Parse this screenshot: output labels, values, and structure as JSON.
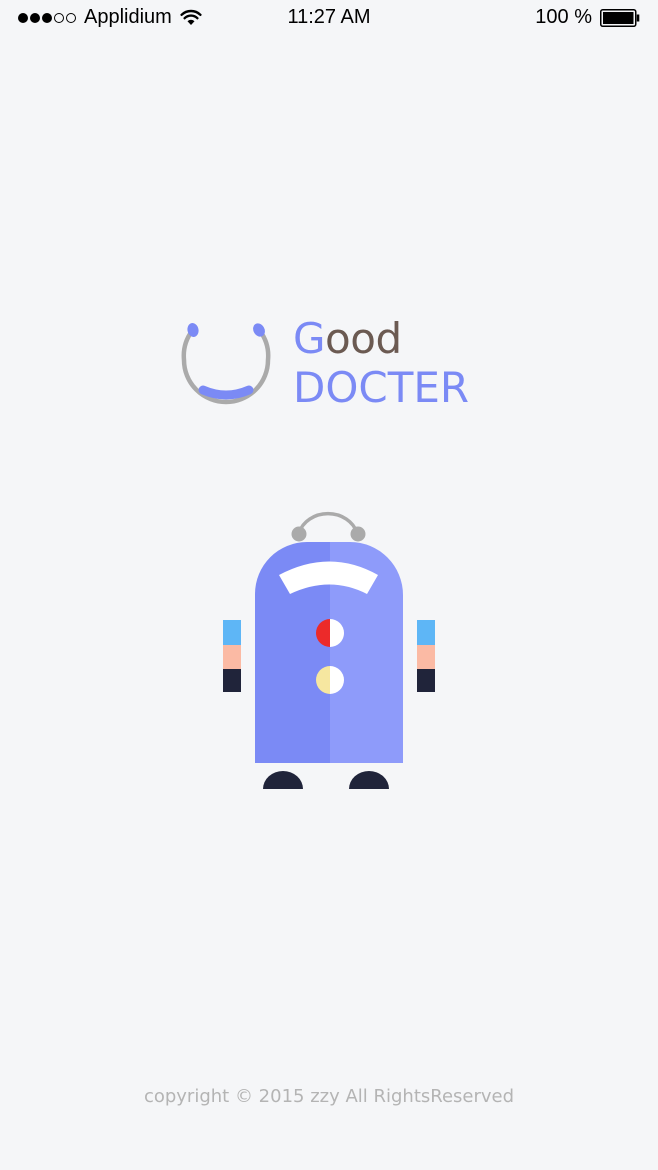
{
  "status_bar": {
    "carrier": "Applidium",
    "time": "11:27 AM",
    "battery_label": "100 %",
    "signal": {
      "filled": 3,
      "empty": 2
    }
  },
  "logo": {
    "line1_first": "G",
    "line1_rest": "ood",
    "line2": "DOCTER"
  },
  "footer": {
    "copyright": "copyright © 2015 zzy All RightsReserved"
  },
  "colors": {
    "background": "#f5f6f8",
    "accent": "#7b8af5",
    "accent_light": "#8e9bfa",
    "brown": "#6b5a52",
    "gray": "#aaaaaa",
    "dark": "#20243a"
  }
}
